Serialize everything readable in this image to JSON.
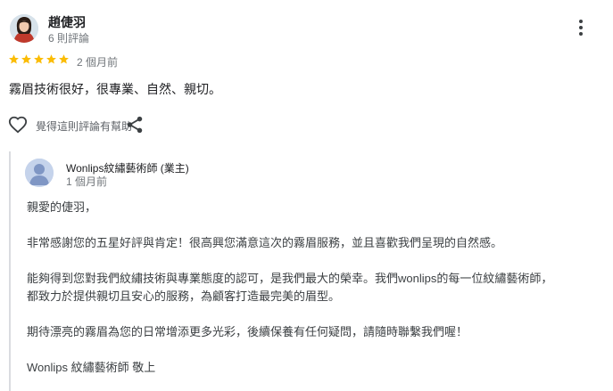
{
  "review": {
    "reviewer_name": "趙倢羽",
    "reviewer_meta": "6 則評論",
    "rating": 5,
    "date": "2 個月前",
    "text": "霧眉技術很好，很專業、自然、親切。",
    "like_label": "覺得這則評論有幫助",
    "icons": {
      "more": "more-vert-icon",
      "like": "heart-outline-icon",
      "share": "share-icon",
      "star": "star-icon"
    },
    "colors": {
      "star": "#fbbc04",
      "text": "#202124",
      "meta": "#70757a"
    }
  },
  "reply": {
    "owner_name": "Wonlips紋繡藝術師 (業主)",
    "date": "1 個月前",
    "lines": [
      "親愛的倢羽，",
      "非常感謝您的五星好評與肯定！很高興您滿意這次的霧眉服務，並且喜歡我們呈現的自然感。",
      "能夠得到您對我們紋繡技術與專業態度的認可，是我們最大的榮幸。我們wonlips的每一位紋繡藝術師，",
      "都致力於提供親切且安心的服務，為顧客打造最完美的眉型。",
      "期待漂亮的霧眉為您的日常增添更多光彩，後續保養有任何疑問，請隨時聯繫我們喔！",
      "Wonlips 紋繡藝術師 敬上"
    ]
  }
}
